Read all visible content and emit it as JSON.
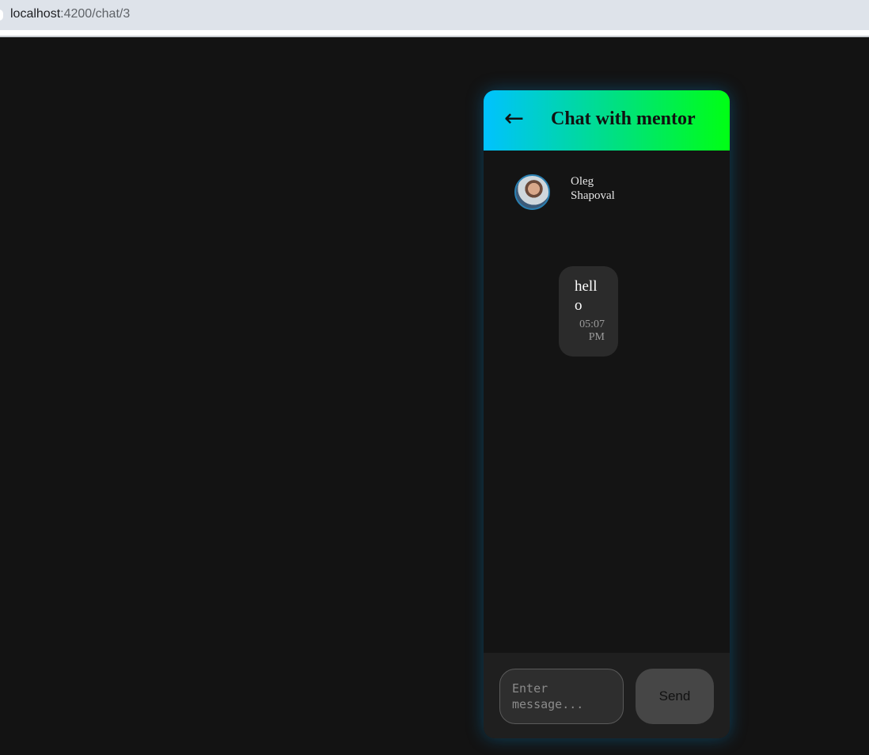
{
  "browser": {
    "url_host": "localhost",
    "url_path": ":4200/chat/3"
  },
  "chat": {
    "back_icon": "←",
    "title": "Chat with mentor",
    "messages": [
      {
        "sender": "Oleg Shapoval",
        "avatar_icon": "user-avatar-photo",
        "text": "hello",
        "time": "05:07 PM"
      }
    ],
    "input": {
      "placeholder": "Enter message...",
      "value": ""
    },
    "send_label": "Send"
  },
  "colors": {
    "background": "#131313",
    "header_gradient_start": "#00c2ff",
    "header_gradient_end": "#00ff14",
    "bubble": "#2b2b2b",
    "send_button": "#464646"
  }
}
